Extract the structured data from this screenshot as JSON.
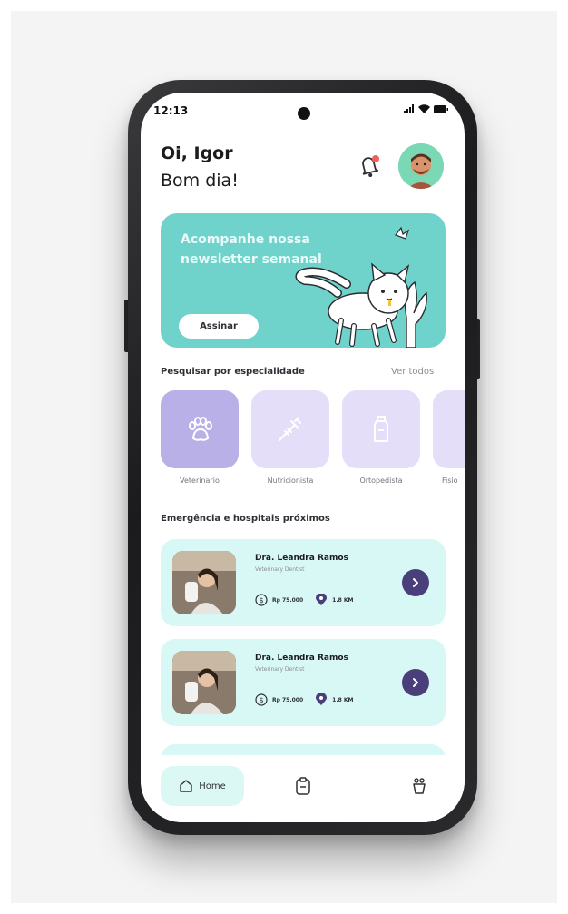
{
  "status_bar": {
    "time": "12:13"
  },
  "greeting": {
    "name": "Oi, Igor",
    "subtitle": "Bom dia!"
  },
  "banner": {
    "text": "Acompanhe nossa newsletter semanal",
    "button_label": "Assinar"
  },
  "specialties": {
    "title": "Pesquisar por especialidade",
    "see_all_label": "Ver todos",
    "items": [
      {
        "label": "Veterinario",
        "icon": "paw-icon",
        "color": "#b9b0e8"
      },
      {
        "label": "Nutricionista",
        "icon": "syringe-icon",
        "color": "#e4def8"
      },
      {
        "label": "Ortopedista",
        "icon": "bottle-icon",
        "color": "#e4def8"
      },
      {
        "label": "Fisio",
        "icon": "generic-icon",
        "color": "#e4def8"
      }
    ]
  },
  "nearby": {
    "title": "Emergência e hospitais próximos",
    "cards": [
      {
        "name": "Dra. Leandra Ramos",
        "role": "Veterinary Dentist",
        "price": "Rp 75.000",
        "distance": "1.8 KM"
      },
      {
        "name": "Dra. Leandra Ramos",
        "role": "Veterinary Dentist",
        "price": "Rp 75.000",
        "distance": "1.8 KM"
      }
    ]
  },
  "bottom_nav": {
    "items": [
      {
        "label": "Home",
        "icon": "home-icon",
        "active": true
      },
      {
        "label": "",
        "icon": "clipboard-icon",
        "active": false
      },
      {
        "label": "",
        "icon": "pet-bowl-icon",
        "active": false
      }
    ]
  },
  "colors": {
    "accent_teal": "#6fd3cc",
    "card_bg": "#d8f8f5",
    "accent_purple": "#4a3f7a",
    "notification_dot": "#f25d5d"
  }
}
